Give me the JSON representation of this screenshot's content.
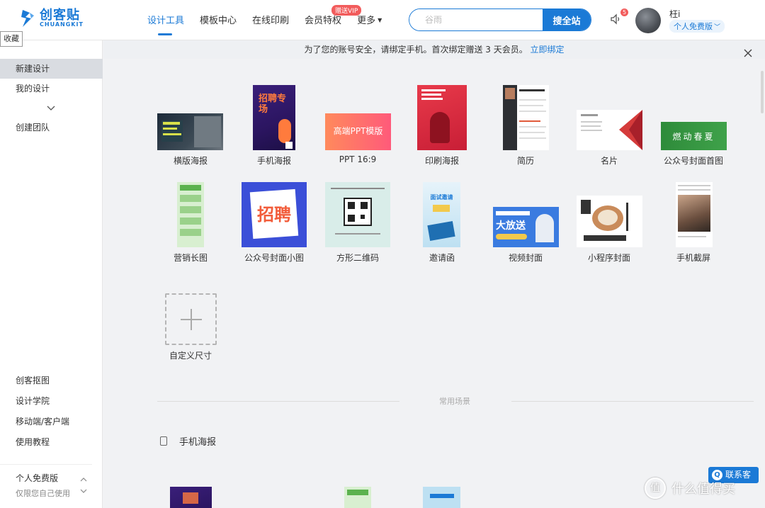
{
  "brand": {
    "name_cn": "创客贴",
    "name_en": "CHUANGKIT",
    "accent": "#1b7ad6"
  },
  "nav": {
    "items": [
      {
        "label": "设计工具"
      },
      {
        "label": "模板中心"
      },
      {
        "label": "在线印刷"
      },
      {
        "label": "会员特权"
      },
      {
        "label": "更多"
      }
    ],
    "vip_badge": "赠送VIP"
  },
  "search": {
    "placeholder": "谷雨",
    "button_label": "搜全站"
  },
  "notifications": {
    "count": "5"
  },
  "user": {
    "name": "枉i",
    "plan": "个人免费版"
  },
  "sidebar": {
    "favorites_tab": "收藏",
    "items": [
      {
        "label": "新建设计"
      },
      {
        "label": "我的设计"
      },
      {
        "label": "创建团队"
      },
      {
        "label": "创客抠图"
      },
      {
        "label": "设计学院"
      },
      {
        "label": "移动端/客户端"
      },
      {
        "label": "使用教程"
      }
    ],
    "plan_name": "个人免费版",
    "plan_desc": "仅限您自己使用"
  },
  "notice": {
    "text": "为了您的账号安全，请绑定手机。首次绑定赠送 3 天会员。",
    "link": "立即绑定"
  },
  "templates": [
    {
      "label": "横版海报",
      "thumb_text": ""
    },
    {
      "label": "手机海报",
      "thumb_text": "招聘专场"
    },
    {
      "label": "PPT 16:9",
      "thumb_text": "高端PPT模版"
    },
    {
      "label": "印刷海报",
      "thumb_text": ""
    },
    {
      "label": "简历",
      "thumb_text": ""
    },
    {
      "label": "名片",
      "thumb_text": ""
    },
    {
      "label": "公众号封面首图",
      "thumb_text": "燃动春夏"
    },
    {
      "label": "营销长图",
      "thumb_text": ""
    },
    {
      "label": "公众号封面小图",
      "thumb_text": "招聘"
    },
    {
      "label": "方形二维码",
      "thumb_text": ""
    },
    {
      "label": "邀请函",
      "thumb_text": "面试邀请"
    },
    {
      "label": "视频封面",
      "thumb_text": "大放送"
    },
    {
      "label": "小程序封面",
      "thumb_text": ""
    },
    {
      "label": "手机截屏",
      "thumb_text": ""
    },
    {
      "label": "自定义尺寸",
      "thumb_text": ""
    }
  ],
  "scenes": {
    "divider_label": "常用场景",
    "section_title": "手机海报"
  },
  "chat": {
    "label": "联系客",
    "icon_glyph": "Q"
  },
  "watermark": {
    "text": "什么值得买",
    "glyph": "值"
  },
  "colors": {
    "accent": "#1b7ad6",
    "badge_red": "#f25c5c",
    "sidebar_active": "#d9dce1"
  }
}
